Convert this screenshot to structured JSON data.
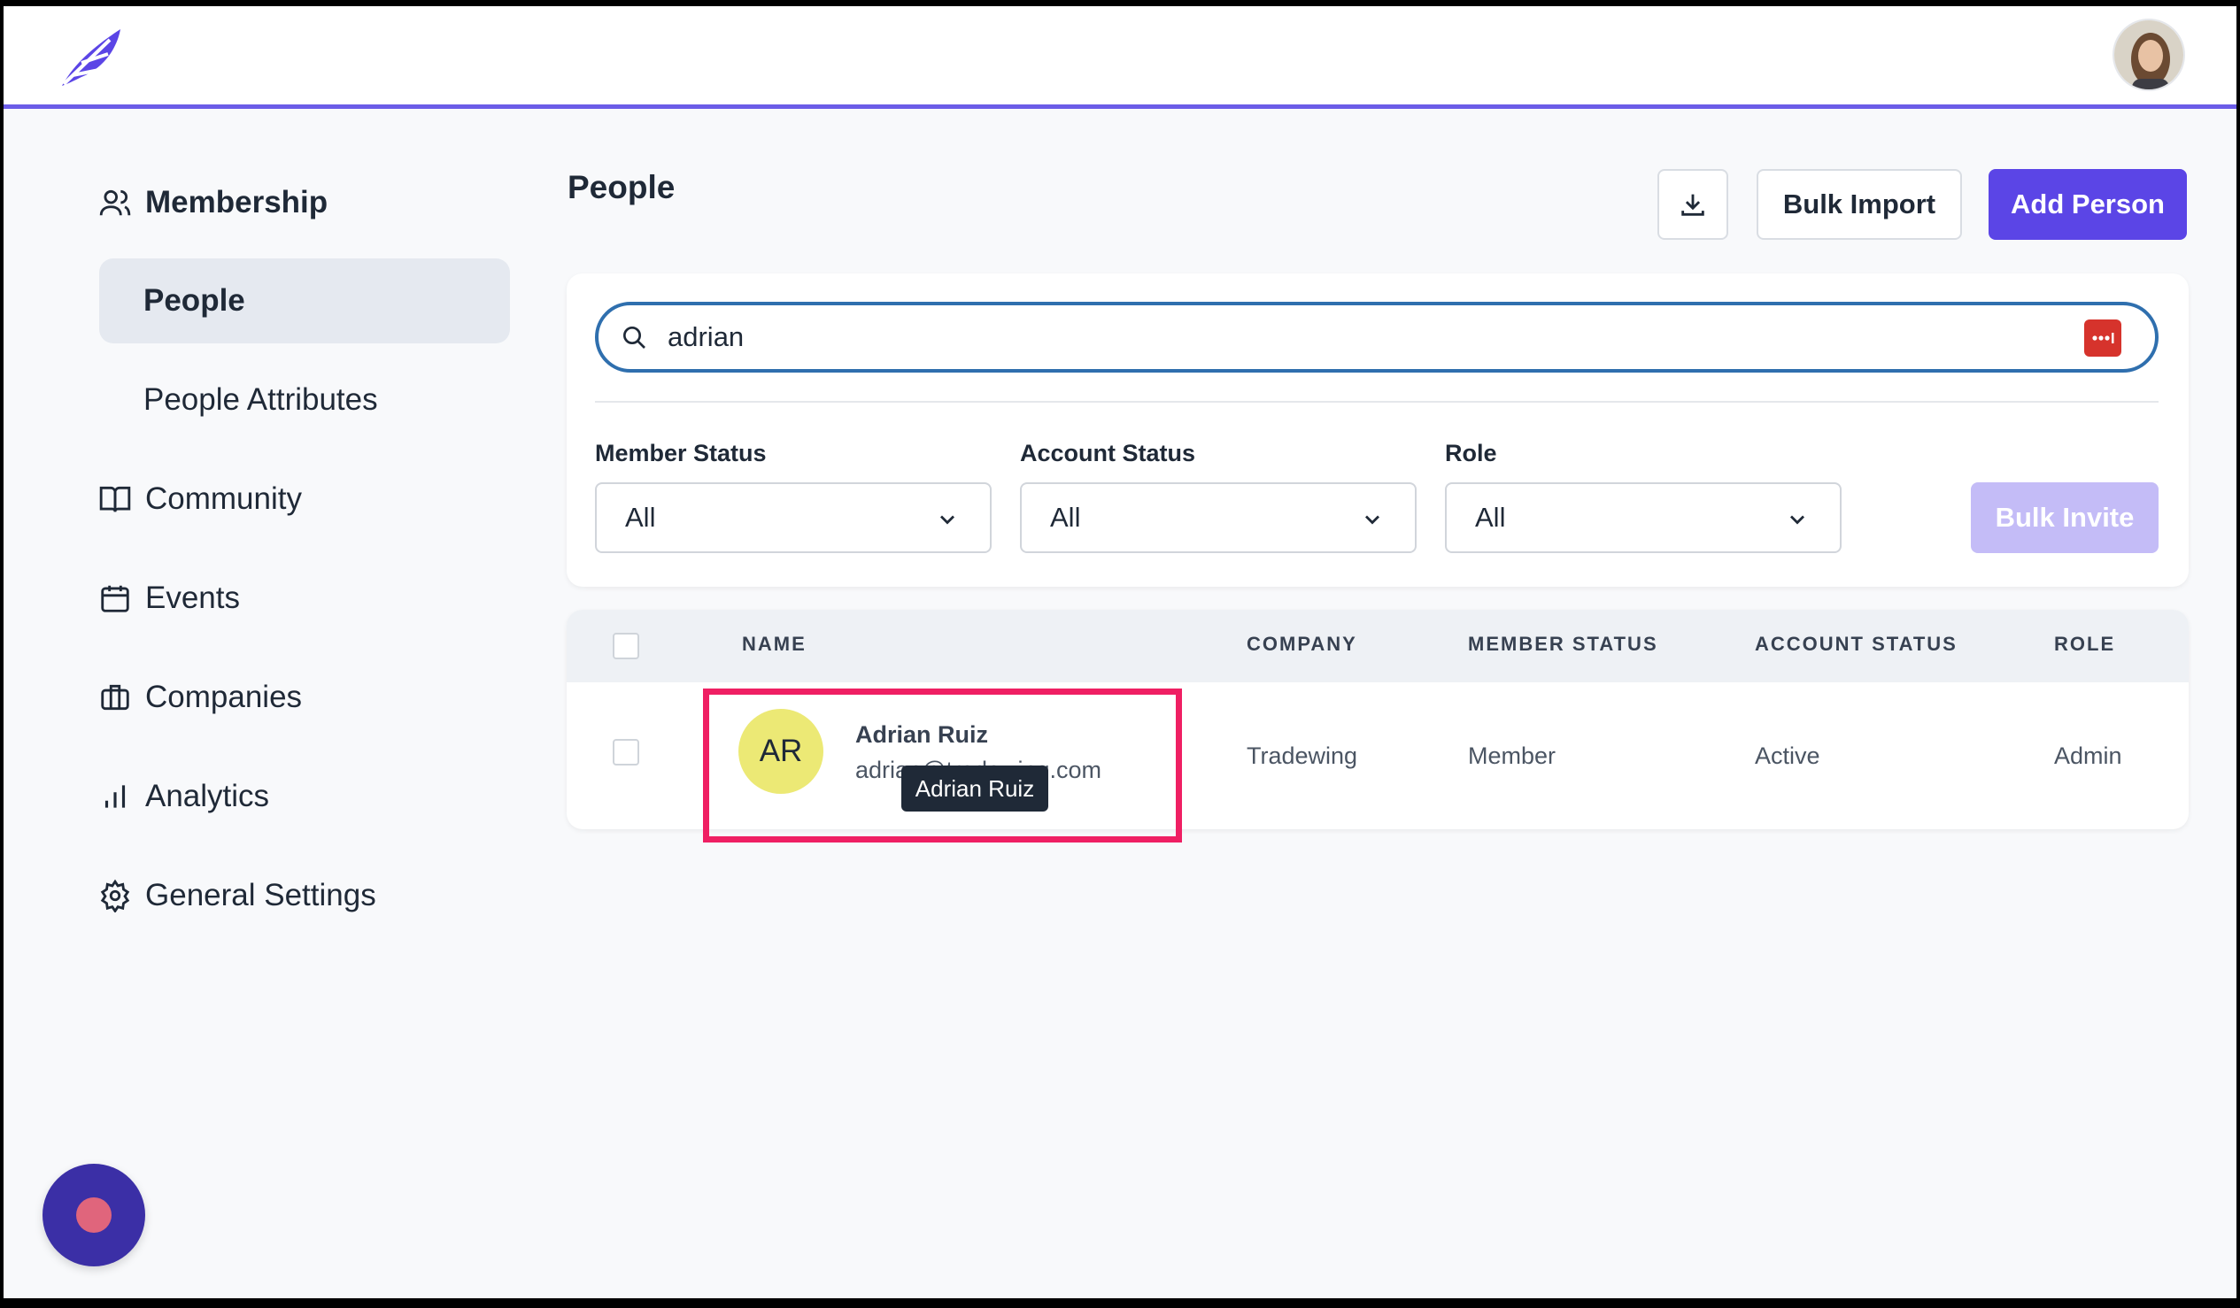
{
  "nav": {
    "membership": "Membership",
    "people": "People",
    "people_attributes": "People Attributes",
    "community": "Community",
    "events": "Events",
    "companies": "Companies",
    "analytics": "Analytics",
    "general_settings": "General Settings"
  },
  "page": {
    "title": "People",
    "bulk_import": "Bulk Import",
    "add_person": "Add Person"
  },
  "search": {
    "value": "adrian"
  },
  "filters": {
    "member_status": {
      "label": "Member Status",
      "value": "All"
    },
    "account_status": {
      "label": "Account Status",
      "value": "All"
    },
    "role": {
      "label": "Role",
      "value": "All"
    },
    "bulk_invite": "Bulk Invite"
  },
  "table": {
    "headers": {
      "name": "NAME",
      "company": "COMPANY",
      "member_status": "MEMBER STATUS",
      "account_status": "ACCOUNT STATUS",
      "role": "ROLE"
    },
    "rows": [
      {
        "initials": "AR",
        "name": "Adrian Ruiz",
        "email": "adrian@tradewing.com",
        "company": "Tradewing",
        "member_status": "Member",
        "account_status": "Active",
        "role": "Admin"
      }
    ]
  },
  "tooltip": "Adrian Ruiz",
  "colors": {
    "accent": "#5b45e6",
    "highlight": "#ef1f63",
    "avatar_bg": "#ece975"
  }
}
